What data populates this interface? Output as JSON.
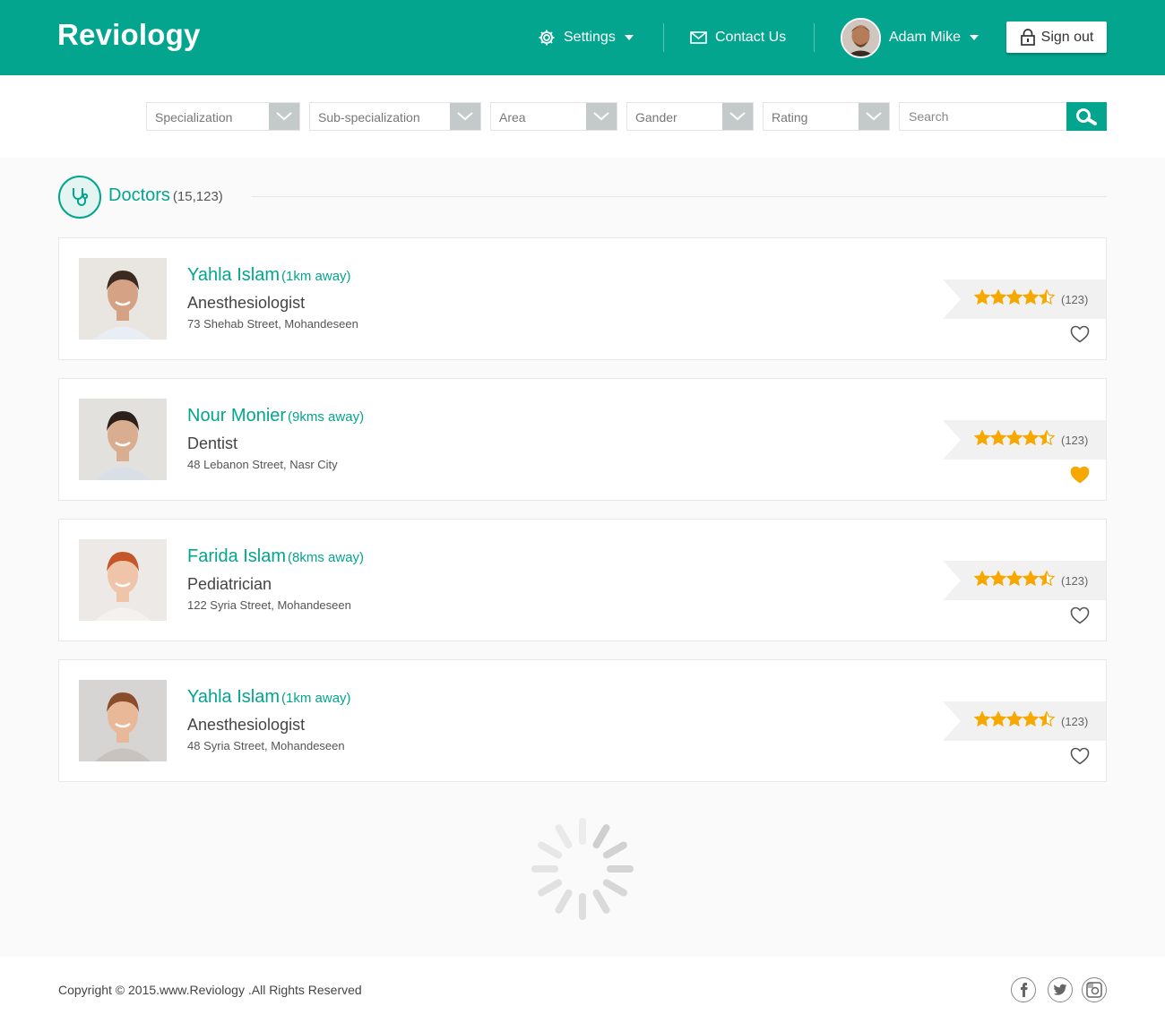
{
  "header": {
    "logo": "Reviology",
    "settings_label": "Settings",
    "contact_label": "Contact Us",
    "user_name": "Adam Mike",
    "signout_label": "Sign out"
  },
  "filters": {
    "specialization": "Specialization",
    "sub_specialization": "Sub-specialization",
    "area": "Area",
    "gender": "Gander",
    "rating": "Rating",
    "search_placeholder": "Search"
  },
  "section": {
    "title": "Doctors",
    "count": "(15,123)"
  },
  "doctors": [
    {
      "name": "Yahla Islam",
      "distance": "(1km away)",
      "specialty": "Anesthesiologist",
      "address": "73 Shehab Street, Mohandeseen",
      "rating": 4.5,
      "reviews": "(123)",
      "favorite": false
    },
    {
      "name": "Nour Monier",
      "distance": "(9kms away)",
      "specialty": "Dentist",
      "address": "48 Lebanon Street, Nasr City",
      "rating": 4.5,
      "reviews": "(123)",
      "favorite": true
    },
    {
      "name": "Farida Islam",
      "distance": "(8kms away)",
      "specialty": "Pediatrician",
      "address": "122 Syria Street, Mohandeseen",
      "rating": 4.5,
      "reviews": "(123)",
      "favorite": false
    },
    {
      "name": "Yahla Islam",
      "distance": "(1km away)",
      "specialty": "Anesthesiologist",
      "address": "48 Syria Street, Mohandeseen",
      "rating": 4.5,
      "reviews": "(123)",
      "favorite": false
    }
  ],
  "footer": {
    "copyright": "Copyright © 2015.www.Reviology .All Rights Reserved",
    "social": [
      "facebook-icon",
      "twitter-icon",
      "instagram-icon"
    ]
  },
  "colors": {
    "primary": "#03a58e",
    "star": "#f7a800",
    "favorite": "#f7a800"
  }
}
